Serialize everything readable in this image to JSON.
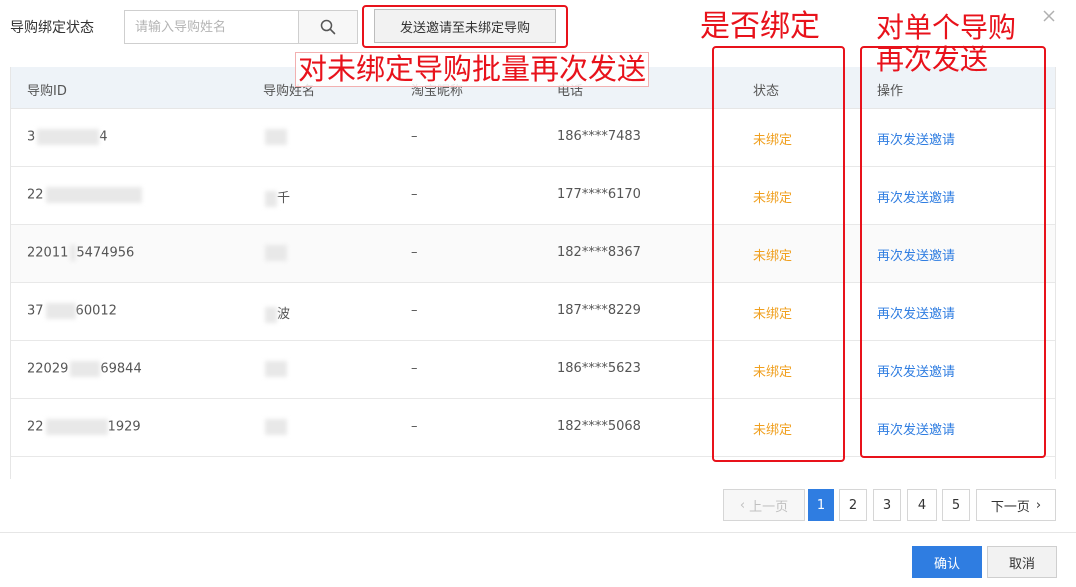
{
  "filter": {
    "label": "导购绑定状态",
    "search_placeholder": "请输入导购姓名",
    "search_icon": "search-icon",
    "batch_button": "发送邀请至未绑定导购",
    "close_icon": "close-icon"
  },
  "table": {
    "columns": [
      "导购ID",
      "导购姓名",
      "淘宝昵称",
      "电话",
      "状态",
      "操作"
    ],
    "rows": [
      {
        "id": "3",
        "id_tail": "4",
        "name": "",
        "taobao": "–",
        "phone": "186****7483",
        "status": "未绑定",
        "action": "再次发送邀请"
      },
      {
        "id": "22",
        "id_tail": "",
        "name": "",
        "name_tail": "千",
        "taobao": "–",
        "phone": "177****6170",
        "status": "未绑定",
        "action": "再次发送邀请"
      },
      {
        "id": "22011",
        "id_tail": "5474956",
        "name": "",
        "taobao": "–",
        "phone": "182****8367",
        "status": "未绑定",
        "action": "再次发送邀请"
      },
      {
        "id": "37",
        "id_tail": "60012",
        "name": "",
        "name_tail": "波",
        "taobao": "–",
        "phone": "187****8229",
        "status": "未绑定",
        "action": "再次发送邀请"
      },
      {
        "id": "22029",
        "id_tail": "69844",
        "name": "",
        "taobao": "–",
        "phone": "186****5623",
        "status": "未绑定",
        "action": "再次发送邀请"
      },
      {
        "id": "22",
        "id_tail": "1929",
        "name": "",
        "taobao": "–",
        "phone": "182****5068",
        "status": "未绑定",
        "action": "再次发送邀请"
      }
    ]
  },
  "pagination": {
    "prev": "上一页",
    "pages": [
      "1",
      "2",
      "3",
      "4",
      "5"
    ],
    "current": "1",
    "next": "下一页"
  },
  "footer": {
    "ok": "确认",
    "cancel": "取消"
  },
  "annotations": {
    "batch_note": "对未绑定导购批量再次发送",
    "status_note": "是否绑定",
    "op_note_line1": "对单个导购",
    "op_note_line2": "再次发送",
    "color": "#e8121b"
  },
  "colors": {
    "primary": "#2f7de1",
    "status_unbound": "#f0a020",
    "header_bg": "#eef3f8"
  }
}
